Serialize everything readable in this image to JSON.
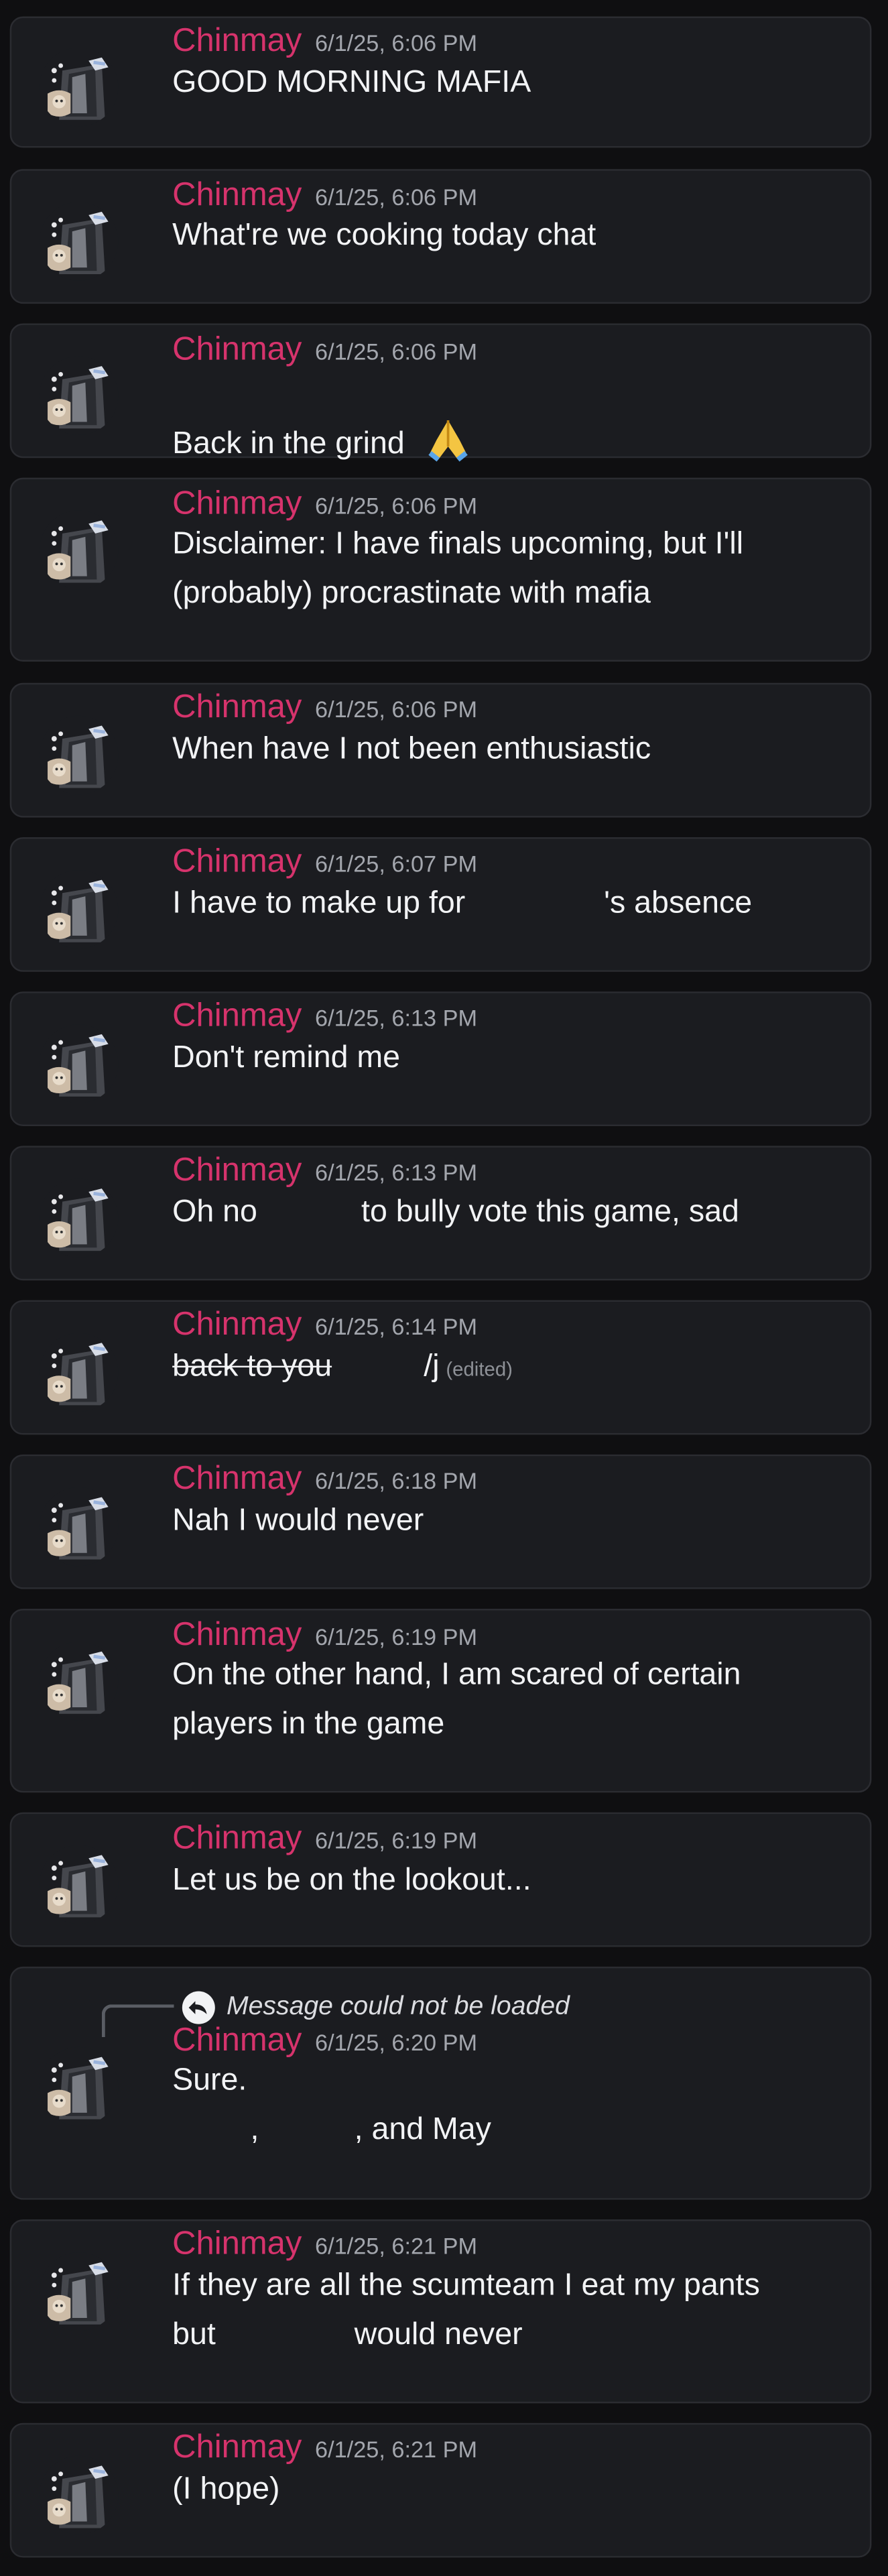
{
  "author": "Chinmay",
  "colors": {
    "background": "#0f0f11",
    "card": "#1b1c20",
    "card_border": "#2b2c31",
    "username": "#d6336c",
    "timestamp": "#a3a6ad",
    "text": "#f2f3f5"
  },
  "messages": [
    {
      "timestamp": "6/1/25, 6:06 PM",
      "lines": [
        "GOOD MORNING MAFIA"
      ]
    },
    {
      "timestamp": "6/1/25, 6:06 PM",
      "lines": [
        "What're we cooking today chat"
      ]
    },
    {
      "timestamp": "6/1/25, 6:06 PM",
      "lines": [
        "Back in the grind"
      ],
      "emoji": "folded-hands-emoji"
    },
    {
      "timestamp": "6/1/25, 6:06 PM",
      "lines": [
        "Disclaimer: I have finals upcoming, but I'll",
        "(probably) procrastinate with mafia"
      ]
    },
    {
      "timestamp": "6/1/25, 6:06 PM",
      "lines": [
        "When have I not been enthusiastic"
      ]
    },
    {
      "timestamp": "6/1/25, 6:07 PM",
      "lines": [
        "I have to make up for                's absence"
      ]
    },
    {
      "timestamp": "6/1/25, 6:13 PM",
      "lines": [
        "Don't remind me"
      ]
    },
    {
      "timestamp": "6/1/25, 6:13 PM",
      "lines": [
        "Oh no            to bully vote this game, sad"
      ]
    },
    {
      "timestamp": "6/1/25, 6:14 PM",
      "strike_text": "back to you",
      "after_text": "/j",
      "edited": "(edited)"
    },
    {
      "timestamp": "6/1/25, 6:18 PM",
      "lines": [
        "Nah I would never"
      ]
    },
    {
      "timestamp": "6/1/25, 6:19 PM",
      "lines": [
        "On the other hand, I am scared of certain",
        "players in the game"
      ]
    },
    {
      "timestamp": "6/1/25, 6:19 PM",
      "lines": [
        "Let us be on the lookout..."
      ]
    },
    {
      "timestamp": "6/1/25, 6:20 PM",
      "reply": "Message could not be loaded",
      "lines": [
        "Sure.",
        "         ,           , and May"
      ]
    },
    {
      "timestamp": "6/1/25, 6:21 PM",
      "lines": [
        "If they are all the scumteam I eat my pants",
        "but                would never"
      ]
    },
    {
      "timestamp": "6/1/25, 6:21 PM",
      "lines": [
        "(I hope)"
      ]
    }
  ]
}
